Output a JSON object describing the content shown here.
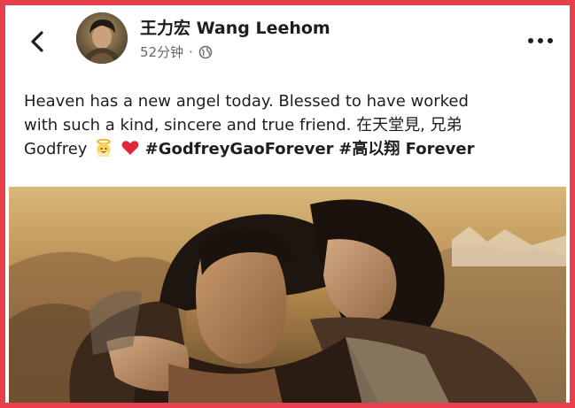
{
  "post": {
    "author": "王力宏 Wang Leehom",
    "timestamp": "52分钟",
    "separator": "·",
    "privacy_icon": "globe-icon",
    "line1": "Heaven has a new angel today.  Blessed to have worked",
    "line2": "with such a kind, sincere and true friend.  在天堂見, 兄弟",
    "line3_prefix": "Godfrey",
    "emoji1": "angel-emoji",
    "emoji2": "red-heart-emoji",
    "hashtag1": "#GodfreyGaoForever",
    "hashtag2": "#高以翔 Forever"
  },
  "colors": {
    "frame_border": "#e8404a",
    "text": "#1c1e21",
    "meta": "#65676b"
  }
}
